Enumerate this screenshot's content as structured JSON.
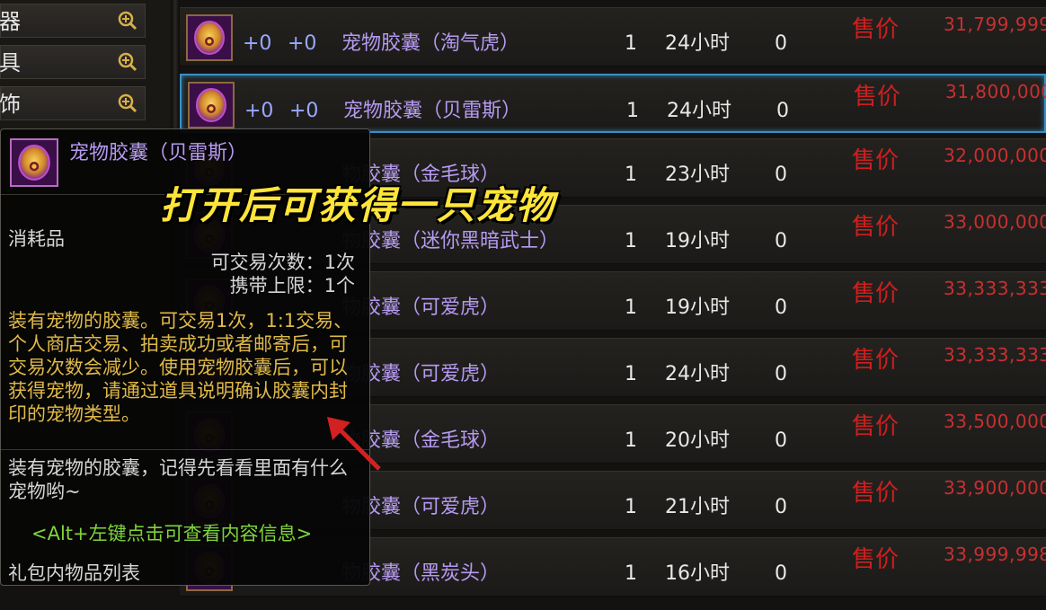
{
  "categories": [
    {
      "label": "器",
      "action": "zoom-icon"
    },
    {
      "label": "具",
      "action": "zoom-icon"
    },
    {
      "label": "饰",
      "action": "zoom-icon"
    }
  ],
  "rows": [
    {
      "enh1": "+0",
      "enh2": "+0",
      "name": "宠物胶囊（淘气虎）",
      "qty": "1",
      "time": "24小时",
      "bids": "0",
      "price_label": "售价",
      "price": "31,799,999"
    },
    {
      "enh1": "+0",
      "enh2": "+0",
      "name": "宠物胶囊（贝雷斯）",
      "qty": "1",
      "time": "24小时",
      "bids": "0",
      "price_label": "售价",
      "price": "31,800,000"
    },
    {
      "enh1": "",
      "enh2": "",
      "name": "物胶囊（金毛球）",
      "qty": "1",
      "time": "23小时",
      "bids": "0",
      "price_label": "售价",
      "price": "32,000,000"
    },
    {
      "enh1": "",
      "enh2": "",
      "name": "物胶囊（迷你黑暗武士）",
      "qty": "1",
      "time": "19小时",
      "bids": "0",
      "price_label": "售价",
      "price": "33,000,000"
    },
    {
      "enh1": "",
      "enh2": "",
      "name": "物胶囊（可爱虎）",
      "qty": "1",
      "time": "19小时",
      "bids": "0",
      "price_label": "售价",
      "price": "33,333,333"
    },
    {
      "enh1": "",
      "enh2": "",
      "name": "物胶囊（可爱虎）",
      "qty": "1",
      "time": "24小时",
      "bids": "0",
      "price_label": "售价",
      "price": "33,333,333"
    },
    {
      "enh1": "",
      "enh2": "",
      "name": "物胶囊（金毛球）",
      "qty": "1",
      "time": "20小时",
      "bids": "0",
      "price_label": "售价",
      "price": "33,500,000"
    },
    {
      "enh1": "",
      "enh2": "",
      "name": "物胶囊（可爱虎）",
      "qty": "1",
      "time": "21小时",
      "bids": "0",
      "price_label": "售价",
      "price": "33,900,000"
    },
    {
      "enh1": "",
      "enh2": "",
      "name": "物胶囊（黑炭头）",
      "qty": "1",
      "time": "16小时",
      "bids": "0",
      "price_label": "售价",
      "price": "33,999,998"
    }
  ],
  "tooltip": {
    "title": "宠物胶囊（贝雷斯）",
    "type": "消耗品",
    "trade_count": "可交易次数：1次",
    "carry_limit": "携带上限：1个",
    "description": "装有宠物的胶囊。可交易1次，1:1交易、个人商店交易、拍卖成功或者邮寄后，可交易次数会减少。使用宠物胶囊后，可以获得宠物，请通过道具说明确认胶囊内封印的宠物类型。",
    "flavor": "装有宠物的胶囊，记得先看看里面有什么宠物哟~",
    "hint": "<Alt+左键点击可查看内容信息>",
    "gift_list": "礼包内物品列表"
  },
  "overlay_caption": "打开后可获得一只宠物",
  "colors": {
    "item_name": "#b59af0",
    "price": "#c83030",
    "selected_border": "#3a8fc4",
    "overlay": "#ffe53a"
  }
}
